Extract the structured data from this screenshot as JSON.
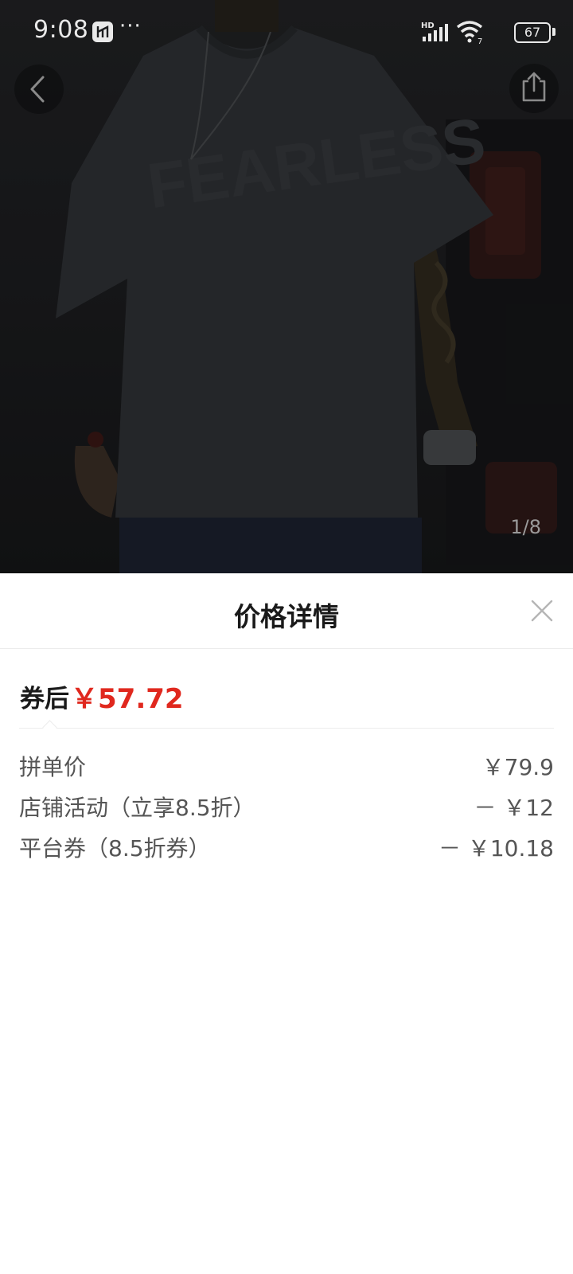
{
  "status_bar": {
    "time": "9:08",
    "more": "···",
    "network": "HD",
    "wifi_badge": "7",
    "battery": "67"
  },
  "gallery": {
    "page_indicator": "1/8",
    "shirt_print": "FEARLESS"
  },
  "sheet": {
    "title": "价格详情",
    "final_label": "券后",
    "final_price": "￥57.72",
    "rows": [
      {
        "label": "拼单价",
        "amount": "￥79.9"
      },
      {
        "label": "店铺活动（立享8.5折）",
        "amount": "－ ￥12"
      },
      {
        "label": "平台券（8.5折券）",
        "amount": "－ ￥10.18"
      }
    ]
  },
  "colors": {
    "accent_price": "#e0281e",
    "text_primary": "#1a1a1a",
    "text_secondary": "#555555"
  },
  "icons": {
    "back": "chevron-left-icon",
    "share": "share-icon",
    "close": "close-icon",
    "signal": "signal-icon",
    "wifi": "wifi-icon",
    "battery": "battery-icon"
  }
}
